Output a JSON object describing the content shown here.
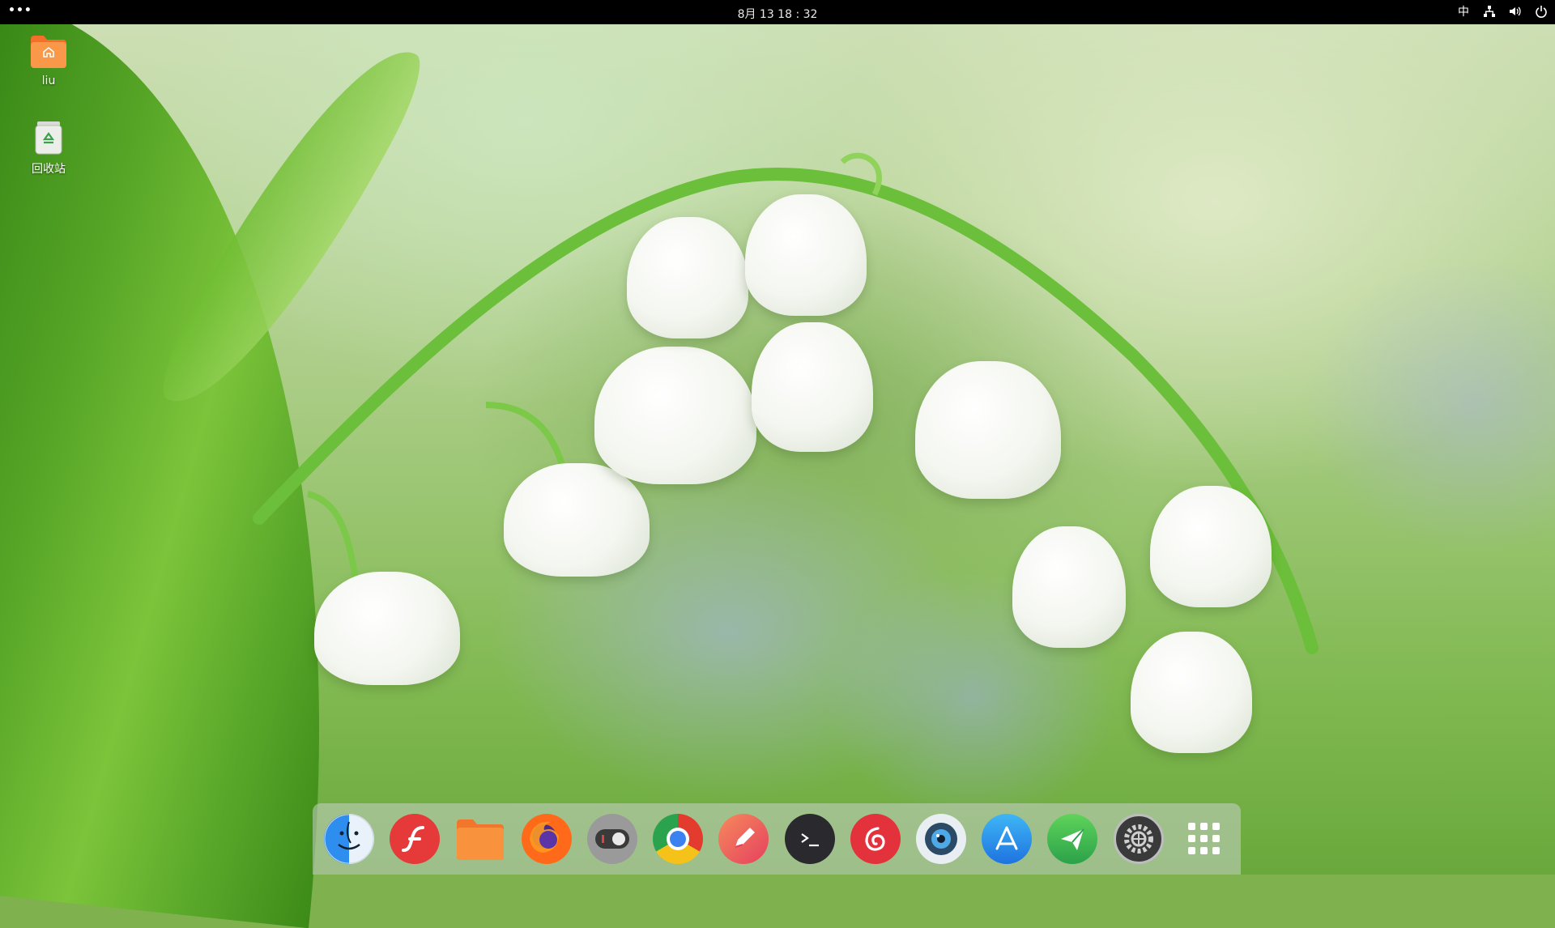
{
  "topbar": {
    "menu_label": "•••",
    "clock": "8月 13  18 : 32",
    "ime": "中"
  },
  "desktop": {
    "icons": [
      {
        "label": "liu",
        "icon": "home-folder-icon"
      },
      {
        "label": "回收站",
        "icon": "trash-icon"
      }
    ]
  },
  "dock": {
    "items": [
      {
        "name": "finder",
        "icon": "finder-face-icon"
      },
      {
        "name": "flash",
        "icon": "flash-icon"
      },
      {
        "name": "files",
        "icon": "folder-icon"
      },
      {
        "name": "firefox",
        "icon": "firefox-icon"
      },
      {
        "name": "toggle",
        "icon": "toggle-switch-icon"
      },
      {
        "name": "chrome",
        "icon": "chrome-icon"
      },
      {
        "name": "editor",
        "icon": "pencil-icon"
      },
      {
        "name": "terminal",
        "icon": "terminal-icon"
      },
      {
        "name": "netease-music",
        "icon": "netease-music-icon"
      },
      {
        "name": "screenshot",
        "icon": "camera-lens-icon"
      },
      {
        "name": "app-store",
        "icon": "app-store-icon"
      },
      {
        "name": "send",
        "icon": "paper-plane-icon"
      },
      {
        "name": "settings",
        "icon": "gear-icon"
      },
      {
        "name": "launcher",
        "icon": "app-grid-icon"
      }
    ]
  },
  "colors": {
    "topbar_bg": "#000000",
    "folder_orange": "#f58a3a"
  }
}
